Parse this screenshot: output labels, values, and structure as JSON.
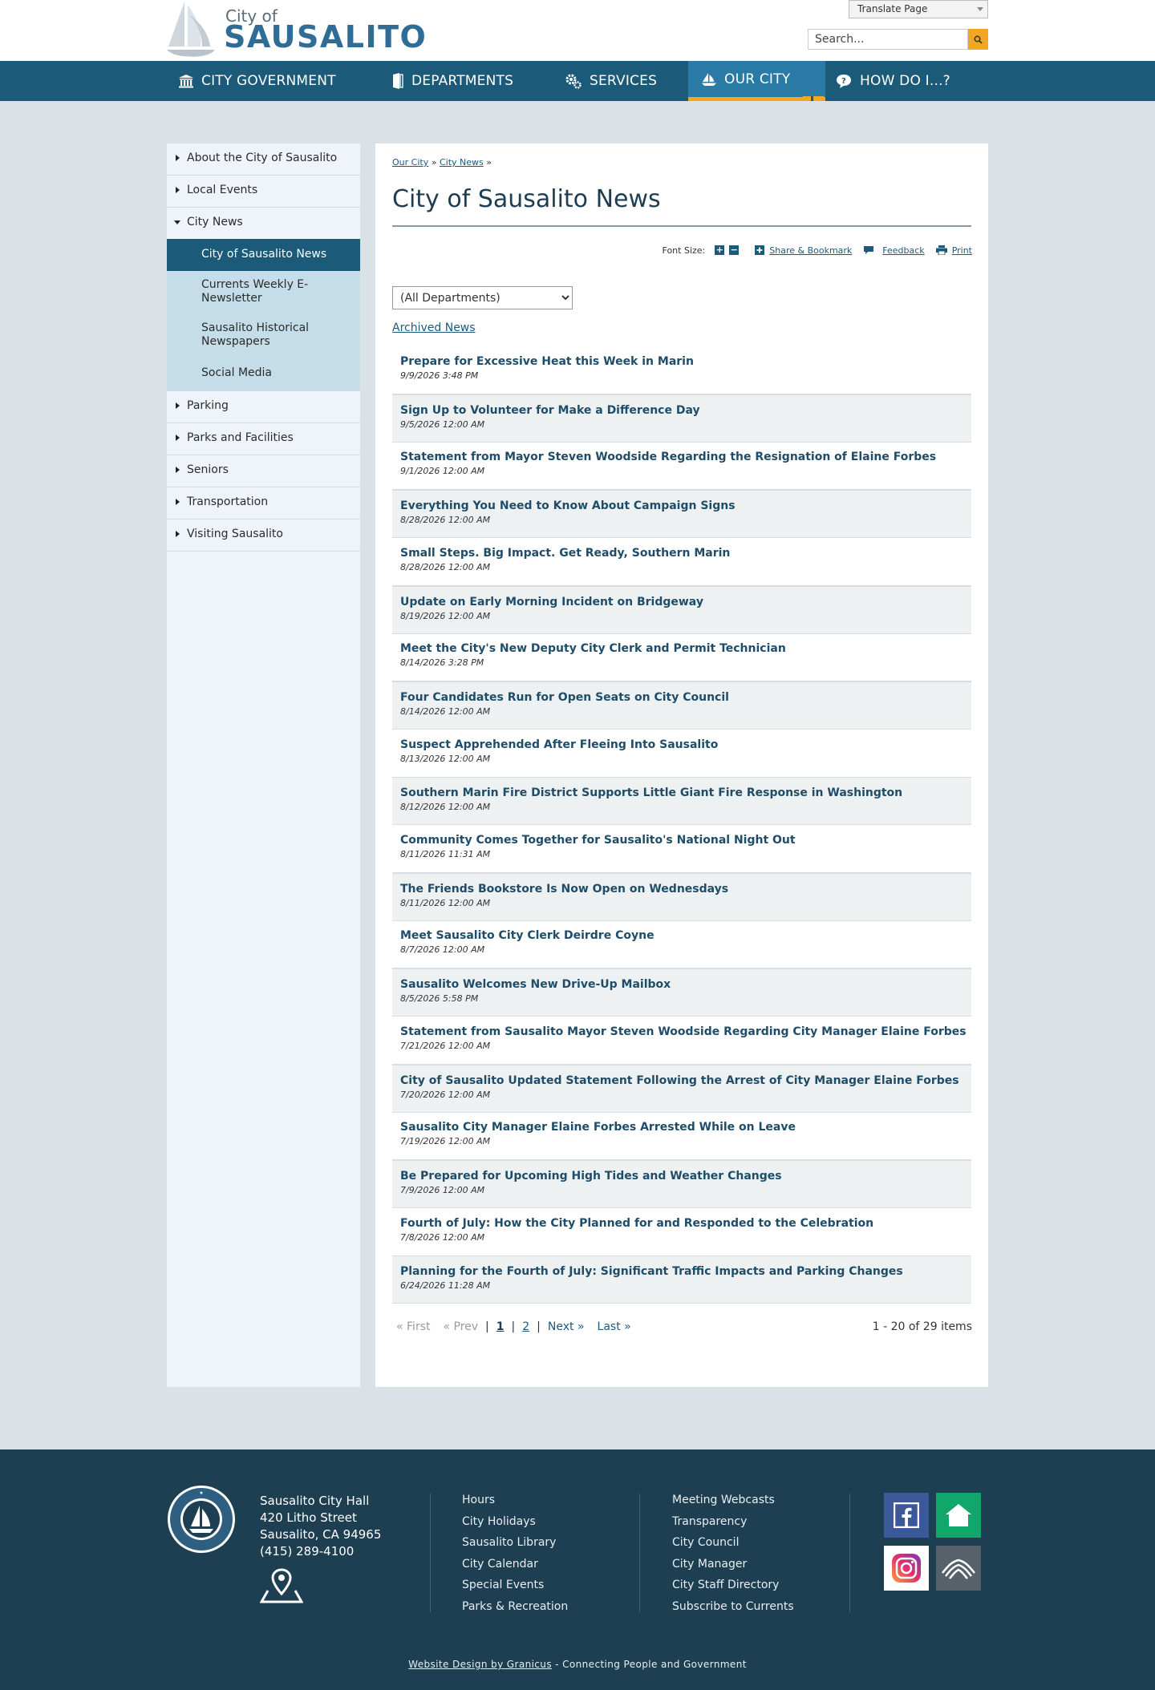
{
  "header": {
    "logo_city_of": "City of",
    "logo_name": "SAUSALITO",
    "translate_label": "Translate Page",
    "search_placeholder": "Search..."
  },
  "nav": [
    {
      "label": "CITY GOVERNMENT",
      "icon": "building-icon"
    },
    {
      "label": "DEPARTMENTS",
      "icon": "door-icon"
    },
    {
      "label": "SERVICES",
      "icon": "gears-icon"
    },
    {
      "label": "OUR CITY",
      "icon": "sailboat-icon",
      "active": true
    },
    {
      "label": "HOW DO I...?",
      "icon": "question-bubble-icon"
    }
  ],
  "sidebar": {
    "items": [
      {
        "label": "About the City of Sausalito"
      },
      {
        "label": "Local Events"
      },
      {
        "label": "City News",
        "expanded": true
      },
      {
        "label": "Parking"
      },
      {
        "label": "Parks and Facilities"
      },
      {
        "label": "Seniors"
      },
      {
        "label": "Transportation"
      },
      {
        "label": "Visiting Sausalito"
      }
    ],
    "sub_items": [
      {
        "label": "City of Sausalito News",
        "active": true
      },
      {
        "label": "Currents Weekly E-Newsletter"
      },
      {
        "label": "Sausalito Historical Newspapers"
      },
      {
        "label": "Social Media"
      }
    ]
  },
  "main": {
    "breadcrumb": {
      "crumb1": "Our City",
      "crumb2": "City News",
      "sep": "»"
    },
    "title": "City of Sausalito News",
    "tools": {
      "font_size_label": "Font Size:",
      "increase": "+",
      "decrease": "−",
      "share_label": "Share & Bookmark",
      "feedback_label": "Feedback",
      "print_label": "Print"
    },
    "department_select": "(All Departments)",
    "archived_label": "Archived News",
    "news": [
      {
        "title": "Prepare for Excessive Heat this Week in Marin",
        "date": "9/9/2026 3:48 PM"
      },
      {
        "title": "Sign Up to Volunteer for Make a Difference Day",
        "date": "9/5/2026 12:00 AM"
      },
      {
        "title": "Statement from Mayor Steven Woodside Regarding the Resignation of Elaine Forbes",
        "date": "9/1/2026 12:00 AM"
      },
      {
        "title": "Everything You Need to Know About Campaign Signs",
        "date": "8/28/2026 12:00 AM"
      },
      {
        "title": "Small Steps. Big Impact. Get Ready, Southern Marin",
        "date": "8/28/2026 12:00 AM"
      },
      {
        "title": "Update on Early Morning Incident on Bridgeway",
        "date": "8/19/2026 12:00 AM"
      },
      {
        "title": "Meet the City's New Deputy City Clerk and Permit Technician",
        "date": "8/14/2026 3:28 PM"
      },
      {
        "title": "Four Candidates Run for Open Seats on City Council",
        "date": "8/14/2026 12:00 AM"
      },
      {
        "title": "Suspect Apprehended After Fleeing Into Sausalito",
        "date": "8/13/2026 12:00 AM"
      },
      {
        "title": "Southern Marin Fire District Supports Little Giant Fire Response in Washington",
        "date": "8/12/2026 12:00 AM"
      },
      {
        "title": "Community Comes Together for Sausalito's National Night Out",
        "date": "8/11/2026 11:31 AM"
      },
      {
        "title": "The Friends Bookstore Is Now Open on Wednesdays",
        "date": "8/11/2026 12:00 AM"
      },
      {
        "title": "Meet Sausalito City Clerk Deirdre Coyne",
        "date": "8/7/2026 12:00 AM"
      },
      {
        "title": "Sausalito Welcomes New Drive-Up Mailbox",
        "date": "8/5/2026 5:58 PM"
      },
      {
        "title": "Statement from Sausalito Mayor Steven Woodside Regarding City Manager Elaine Forbes",
        "date": "7/21/2026 12:00 AM"
      },
      {
        "title": "City of Sausalito Updated Statement Following the Arrest of City Manager Elaine Forbes",
        "date": "7/20/2026 12:00 AM"
      },
      {
        "title": "Sausalito City Manager Elaine Forbes Arrested While on Leave",
        "date": "7/19/2026 12:00 AM"
      },
      {
        "title": "Be Prepared for Upcoming High Tides and Weather Changes",
        "date": "7/9/2026 12:00 AM"
      },
      {
        "title": "Fourth of July: How the City Planned for and Responded to the Celebration",
        "date": "7/8/2026 12:00 AM"
      },
      {
        "title": "Planning for the Fourth of July: Significant Traffic Impacts and Parking Changes",
        "date": "6/24/2026 11:28 AM"
      }
    ],
    "pager": {
      "first": "« First",
      "prev": "« Prev",
      "sep": "|",
      "page1": "1",
      "page2": "2",
      "next": "Next »",
      "last": "Last »"
    },
    "count": "1 - 20 of 29 items"
  },
  "footer": {
    "seal_text": "CITY OF SAUSALITO · MARIN CO · CALIF",
    "address": {
      "line1": "Sausalito City Hall",
      "line2": "420 Litho Street",
      "line3": "Sausalito, CA 94965",
      "phone": "(415) 289-4100"
    },
    "col1": [
      "Hours",
      "City Holidays",
      "Sausalito Library",
      "City Calendar",
      "Special Events",
      "Parks & Recreation"
    ],
    "col2": [
      "Meeting Webcasts",
      "Transparency",
      "City Council",
      "City Manager",
      "City Staff Directory",
      "Subscribe to Currents"
    ],
    "social": [
      "facebook-icon",
      "nextdoor-icon",
      "instagram-icon",
      "waves-icon"
    ],
    "credit_link": "Website Design by Granicus",
    "credit_text": " - Connecting People and Government",
    "colors": {
      "footer_bg": "#1e3f52",
      "nav_bg": "#1c5a7a",
      "accent": "#f2a623"
    }
  }
}
